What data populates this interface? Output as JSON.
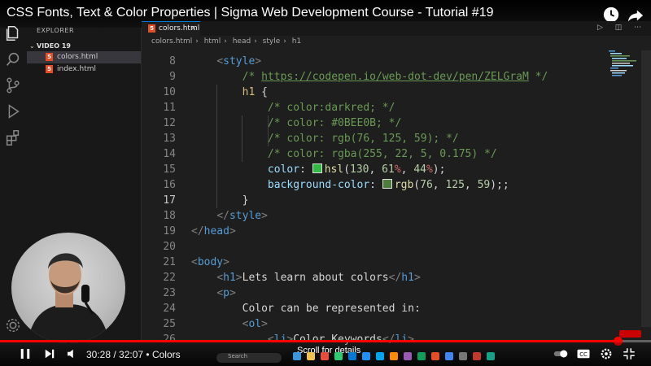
{
  "video": {
    "title": "CSS Fonts, Text & Color Properties | Sigma Web Development Course - Tutorial #19",
    "time_current": "30:28",
    "time_total": "32:07",
    "chapter": "Colors",
    "progress_fraction": 0.949,
    "scroll_hint": "Scroll for details"
  },
  "explorer": {
    "title": "EXPLORER",
    "folder": "VIDEO 19",
    "files": [
      {
        "name": "colors.html",
        "active": true
      },
      {
        "name": "index.html",
        "active": false
      }
    ]
  },
  "editor": {
    "tab_label": "colors.html",
    "breadcrumb": [
      "colors.html",
      "html",
      "head",
      "style",
      "h1"
    ],
    "swatch_green": "#2fba44",
    "swatch_olive": "#4c7d3b",
    "accent": "#0078d4"
  },
  "code_lines": [
    {
      "n": "8",
      "code": "    <style>"
    },
    {
      "n": "9",
      "code": "        /* https://codepen.io/web-dot-dev/pen/ZELGraM */"
    },
    {
      "n": "10",
      "code": "        h1 {"
    },
    {
      "n": "11",
      "code": "            /* color:darkred; */"
    },
    {
      "n": "12",
      "code": "            /* color: #0BEE0B; */"
    },
    {
      "n": "13",
      "code": "            /* color: rgb(76, 125, 59); */"
    },
    {
      "n": "14",
      "code": "            /* color: rgba(255, 22, 5, 0.175) */"
    },
    {
      "n": "15",
      "code": "            color: hsl(130, 61%, 44%);"
    },
    {
      "n": "16",
      "code": "            background-color: rgb(76, 125, 59);;"
    },
    {
      "n": "17",
      "code": "        }"
    },
    {
      "n": "18",
      "code": "    </style>"
    },
    {
      "n": "19",
      "code": "</head>"
    },
    {
      "n": "20",
      "code": ""
    },
    {
      "n": "21",
      "code": "<body>"
    },
    {
      "n": "22",
      "code": "    <h1>Lets learn about colors</h1>"
    },
    {
      "n": "23",
      "code": "    <p>"
    },
    {
      "n": "24",
      "code": "        Color can be represented in:"
    },
    {
      "n": "25",
      "code": "        <ol>"
    },
    {
      "n": "26",
      "code": "            <li>Color Keywords</li>"
    }
  ],
  "taskbar": {
    "search": "Search"
  }
}
